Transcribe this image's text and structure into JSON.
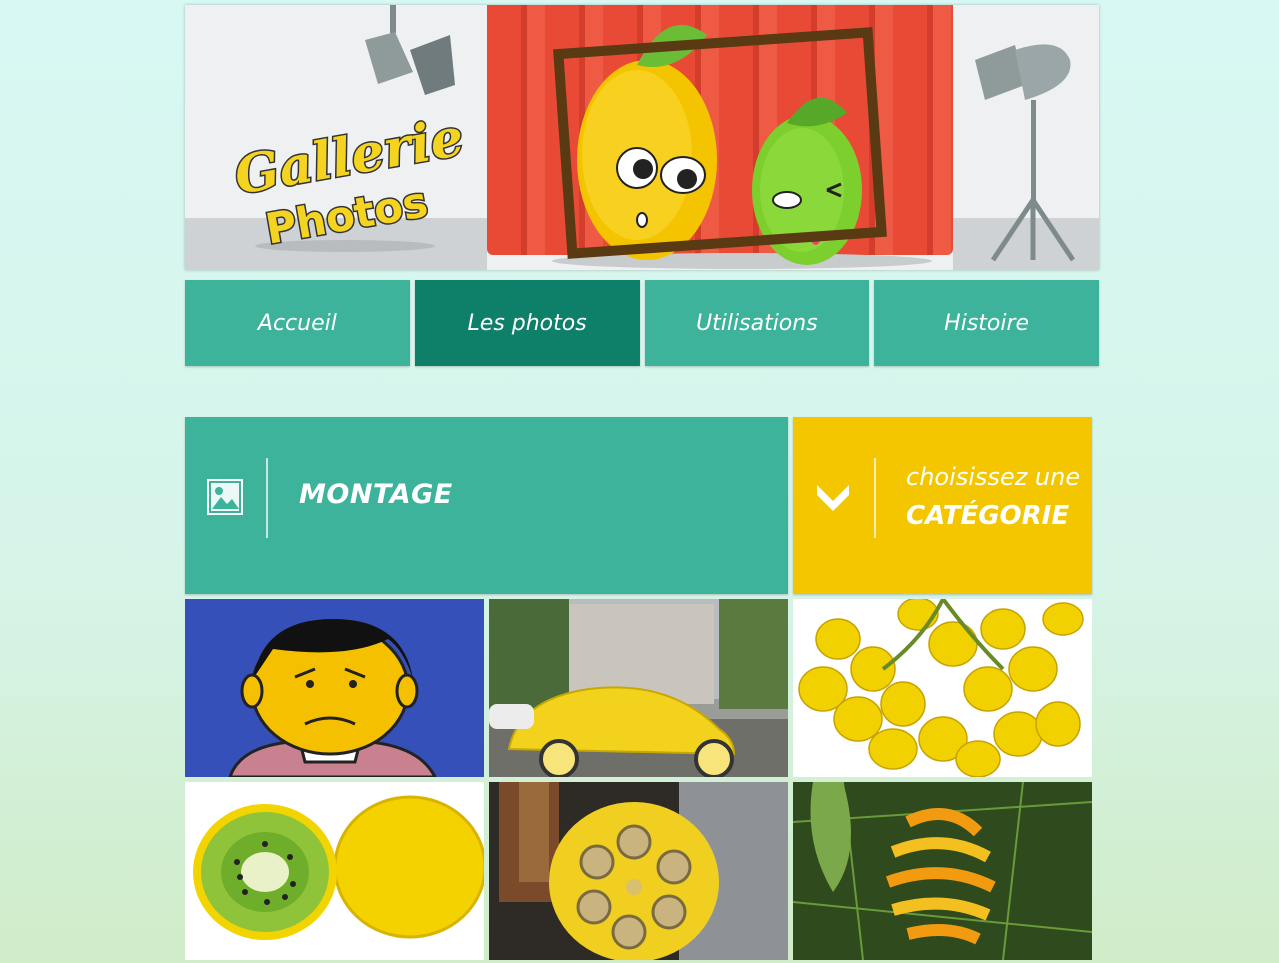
{
  "banner": {
    "logo_line1": "Gallerie",
    "logo_line2": "Photos"
  },
  "nav": {
    "items": [
      {
        "label": "Accueil",
        "active": false
      },
      {
        "label": "Les photos",
        "active": true
      },
      {
        "label": "Utilisations",
        "active": false
      },
      {
        "label": "Histoire",
        "active": false
      }
    ]
  },
  "category": {
    "current": "MONTAGE",
    "icon": "image-icon"
  },
  "selector": {
    "line1": "choisissez une",
    "line2": "CATÉGORIE",
    "icon": "chevron-down-icon"
  },
  "colors": {
    "teal": "#3db39b",
    "teal_dark": "#0e806a",
    "yellow": "#f3c600",
    "curtain_red": "#e84a36"
  }
}
